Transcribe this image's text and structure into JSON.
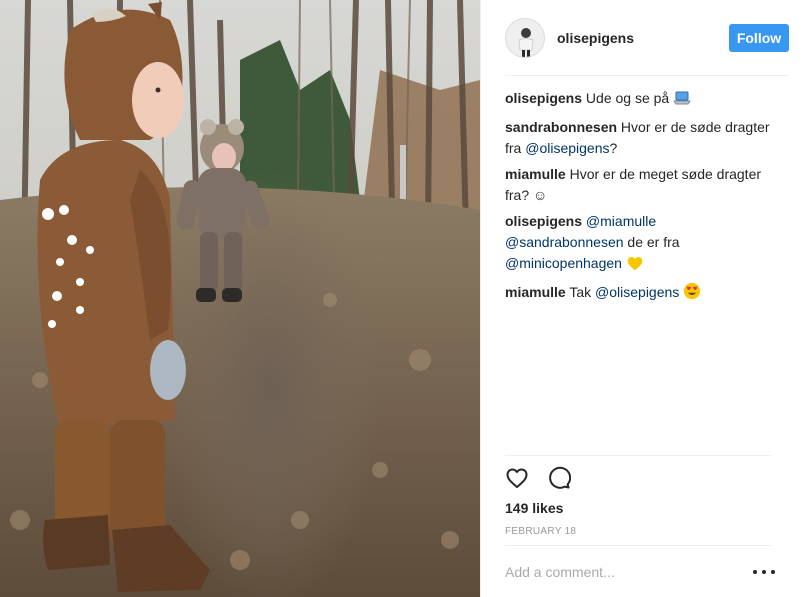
{
  "post": {
    "username": "olisepigens",
    "follow_label": "Follow",
    "likes": "149 likes",
    "date": "FEBRUARY 18"
  },
  "comments": [
    {
      "author": "olisepigens",
      "parts": [
        {
          "t": "text",
          "v": "Ude og se på "
        }
      ],
      "emoji": "laptop"
    },
    {
      "author": "sandrabonnesen",
      "parts": [
        {
          "t": "text",
          "v": "Hvor er de søde dragter fra "
        },
        {
          "t": "mention",
          "v": "@olisepigens"
        },
        {
          "t": "text",
          "v": "?"
        }
      ]
    },
    {
      "author": "miamulle",
      "parts": [
        {
          "t": "text",
          "v": "Hvor er de meget søde dragter fra? ☺"
        }
      ]
    },
    {
      "author": "olisepigens",
      "parts": [
        {
          "t": "mention",
          "v": "@miamulle"
        },
        {
          "t": "text",
          "v": " "
        },
        {
          "t": "mention",
          "v": "@sandrabonnesen"
        },
        {
          "t": "text",
          "v": " de er fra "
        },
        {
          "t": "mention",
          "v": "@minicopenhagen"
        },
        {
          "t": "text",
          "v": " "
        }
      ],
      "emoji": "yellow-heart"
    },
    {
      "author": "miamulle",
      "parts": [
        {
          "t": "text",
          "v": "Tak "
        },
        {
          "t": "mention",
          "v": "@olisepigens"
        },
        {
          "t": "text",
          "v": " "
        }
      ],
      "emoji": "heart-eyes"
    }
  ],
  "actions": {
    "like_icon": "heart-icon",
    "comment_icon": "comment-icon"
  },
  "comment_box": {
    "placeholder": "Add a comment...",
    "more_icon": "more-options-icon"
  },
  "colors": {
    "accent": "#3897f0",
    "mention": "#003569",
    "text": "#262626",
    "muted": "#999999"
  }
}
